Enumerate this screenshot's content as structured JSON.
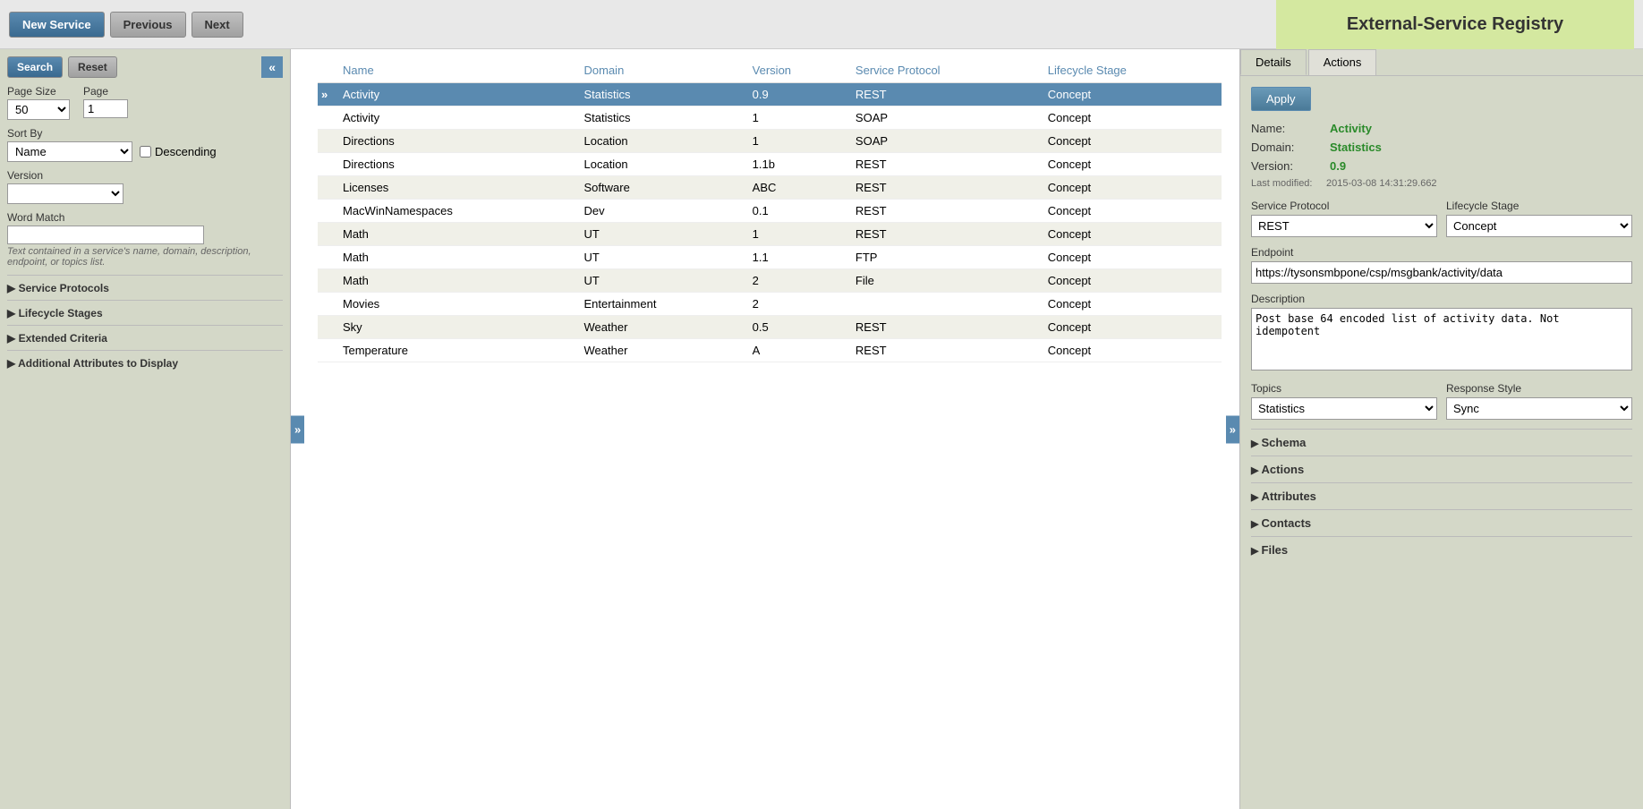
{
  "header": {
    "title": "External-Service Registry",
    "buttons": {
      "new_service": "New Service",
      "previous": "Previous",
      "next": "Next"
    }
  },
  "sidebar": {
    "search_label": "Search",
    "reset_label": "Reset",
    "toggle_label": "«",
    "page_size_label": "Page Size",
    "page_size_value": "50",
    "page_label": "Page",
    "page_value": "1",
    "sort_by_label": "Sort By",
    "sort_by_value": "Name",
    "descending_label": "Descending",
    "version_label": "Version",
    "word_match_label": "Word Match",
    "word_match_hint": "Text contained in a service's name, domain, description, endpoint, or topics list.",
    "sections": [
      {
        "title": "Service Protocols"
      },
      {
        "title": "Lifecycle Stages"
      },
      {
        "title": "Extended Criteria"
      },
      {
        "title": "Additional Attributes to Display"
      }
    ]
  },
  "table": {
    "toggle_left": "»",
    "toggle_right": "»",
    "columns": [
      "Name",
      "Domain",
      "Version",
      "Service Protocol",
      "Lifecycle Stage"
    ],
    "selected_row": 0,
    "rows": [
      {
        "name": "Activity",
        "domain": "Statistics",
        "version": "0.9",
        "protocol": "REST",
        "stage": "Concept",
        "selected": true
      },
      {
        "name": "Activity",
        "domain": "Statistics",
        "version": "1",
        "protocol": "SOAP",
        "stage": "Concept",
        "selected": false
      },
      {
        "name": "Directions",
        "domain": "Location",
        "version": "1",
        "protocol": "SOAP",
        "stage": "Concept",
        "selected": false
      },
      {
        "name": "Directions",
        "domain": "Location",
        "version": "1.1b",
        "protocol": "REST",
        "stage": "Concept",
        "selected": false
      },
      {
        "name": "Licenses",
        "domain": "Software",
        "version": "ABC",
        "protocol": "REST",
        "stage": "Concept",
        "selected": false
      },
      {
        "name": "MacWinNamespaces",
        "domain": "Dev",
        "version": "0.1",
        "protocol": "REST",
        "stage": "Concept",
        "selected": false
      },
      {
        "name": "Math",
        "domain": "UT",
        "version": "1",
        "protocol": "REST",
        "stage": "Concept",
        "selected": false
      },
      {
        "name": "Math",
        "domain": "UT",
        "version": "1.1",
        "protocol": "FTP",
        "stage": "Concept",
        "selected": false
      },
      {
        "name": "Math",
        "domain": "UT",
        "version": "2",
        "protocol": "File",
        "stage": "Concept",
        "selected": false
      },
      {
        "name": "Movies",
        "domain": "Entertainment",
        "version": "2",
        "protocol": "",
        "stage": "Concept",
        "selected": false
      },
      {
        "name": "Sky",
        "domain": "Weather",
        "version": "0.5",
        "protocol": "REST",
        "stage": "Concept",
        "selected": false
      },
      {
        "name": "Temperature",
        "domain": "Weather",
        "version": "A",
        "protocol": "REST",
        "stage": "Concept",
        "selected": false
      }
    ]
  },
  "detail_panel": {
    "tabs": [
      "Details",
      "Actions"
    ],
    "active_tab": "Details",
    "apply_label": "Apply",
    "name_label": "Name:",
    "name_value": "Activity",
    "domain_label": "Domain:",
    "domain_value": "Statistics",
    "version_label": "Version:",
    "version_value": "0.9",
    "last_modified_label": "Last modified:",
    "last_modified_value": "2015-03-08 14:31:29.662",
    "service_protocol_label": "Service Protocol",
    "service_protocol_value": "REST",
    "lifecycle_stage_label": "Lifecycle Stage",
    "lifecycle_stage_value": "Concept",
    "endpoint_label": "Endpoint",
    "endpoint_value": "https://tysonsmbpone/csp/msgbank/activity/data",
    "description_label": "Description",
    "description_value": "Post base 64 encoded list of activity data. Not\nidempotent",
    "topics_label": "Topics",
    "topics_value": "Statistics",
    "response_style_label": "Response Style",
    "response_style_value": "Sync",
    "collapsible_sections": [
      {
        "title": "Schema"
      },
      {
        "title": "Actions"
      },
      {
        "title": "Attributes"
      },
      {
        "title": "Contacts"
      },
      {
        "title": "Files"
      }
    ]
  }
}
